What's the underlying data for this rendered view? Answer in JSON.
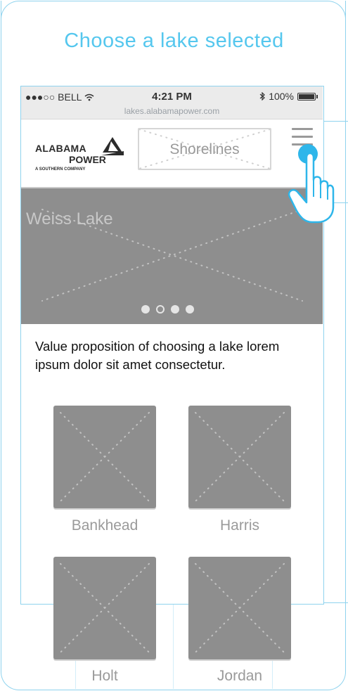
{
  "title": "Choose a lake selected",
  "status_bar": {
    "carrier": "●●●○○ BELL",
    "time": "4:21 PM",
    "battery": "100%",
    "url": "lakes.alabamapower.com"
  },
  "header": {
    "logo_line1": "ALABAMA",
    "logo_line2": "POWER",
    "logo_sub": "A SOUTHERN COMPANY",
    "site_label": "Shorelines"
  },
  "hero": {
    "title": "Weiss Lake",
    "slide_count": 4,
    "active_slide": 2
  },
  "value_proposition": "Value proposition of choosing a lake lorem ipsum dolor sit amet consectetur.",
  "lakes": [
    "Bankhead",
    "Harris",
    "Holt",
    "Jordan"
  ],
  "colors": {
    "accent": "#55c7ee",
    "wireframe_gray": "#8e8e8e",
    "touch": "#2eb6ea"
  },
  "icons": [
    "wifi-icon",
    "bluetooth-icon",
    "battery-icon",
    "menu-icon",
    "tap-hand-icon"
  ]
}
